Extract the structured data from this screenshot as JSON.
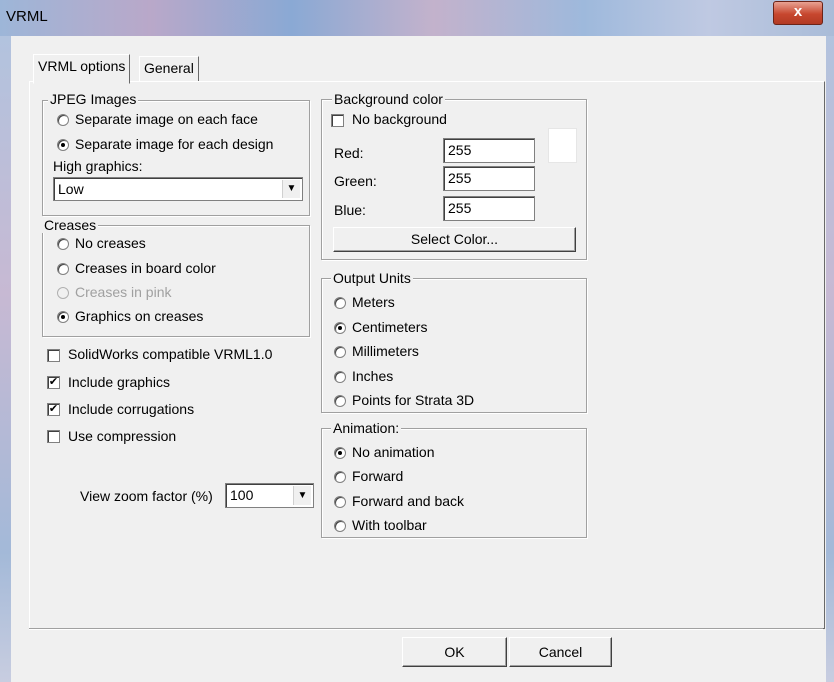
{
  "window": {
    "title": "VRML",
    "close_glyph": "x"
  },
  "tabs": [
    {
      "label": "VRML options"
    },
    {
      "label": "General"
    }
  ],
  "jpeg": {
    "title": "JPEG Images",
    "options": [
      {
        "label": "Separate image on each face",
        "selected": false
      },
      {
        "label": "Separate image for each design",
        "selected": true
      }
    ],
    "high_graphics_label": "High graphics:",
    "high_graphics_value": "Low"
  },
  "creases": {
    "title": "Creases",
    "options": [
      {
        "label": "No creases",
        "selected": false
      },
      {
        "label": "Creases in board color",
        "selected": false
      },
      {
        "label": "Creases in pink",
        "selected": false,
        "disabled": true
      },
      {
        "label": "Graphics on creases",
        "selected": true
      }
    ]
  },
  "checkboxes": [
    {
      "label": "SolidWorks compatible VRML1.0",
      "checked": false
    },
    {
      "label": "Include graphics",
      "checked": true
    },
    {
      "label": "Include corrugations",
      "checked": true
    },
    {
      "label": "Use compression",
      "checked": false
    }
  ],
  "zoom": {
    "label": "View zoom factor (%)",
    "value": "100"
  },
  "background": {
    "title": "Background color",
    "no_background_label": "No background",
    "no_background_checked": false,
    "red_label": "Red:",
    "red": "255",
    "green_label": "Green:",
    "green": "255",
    "blue_label": "Blue:",
    "blue": "255",
    "swatch_color": "#ffffff",
    "select_label": "Select Color..."
  },
  "units": {
    "title": "Output Units",
    "options": [
      {
        "label": "Meters",
        "selected": false
      },
      {
        "label": "Centimeters",
        "selected": true
      },
      {
        "label": "Millimeters",
        "selected": false
      },
      {
        "label": "Inches",
        "selected": false
      },
      {
        "label": "Points for Strata 3D",
        "selected": false
      }
    ]
  },
  "animation": {
    "title": "Animation:",
    "options": [
      {
        "label": "No animation",
        "selected": true
      },
      {
        "label": "Forward",
        "selected": false
      },
      {
        "label": "Forward and back",
        "selected": false
      },
      {
        "label": "With toolbar",
        "selected": false
      }
    ]
  },
  "footer": {
    "ok_label": "OK",
    "cancel_label": "Cancel"
  },
  "icons": {
    "checkmark": "✔",
    "dropdown": "▼",
    "close": "close-icon"
  }
}
